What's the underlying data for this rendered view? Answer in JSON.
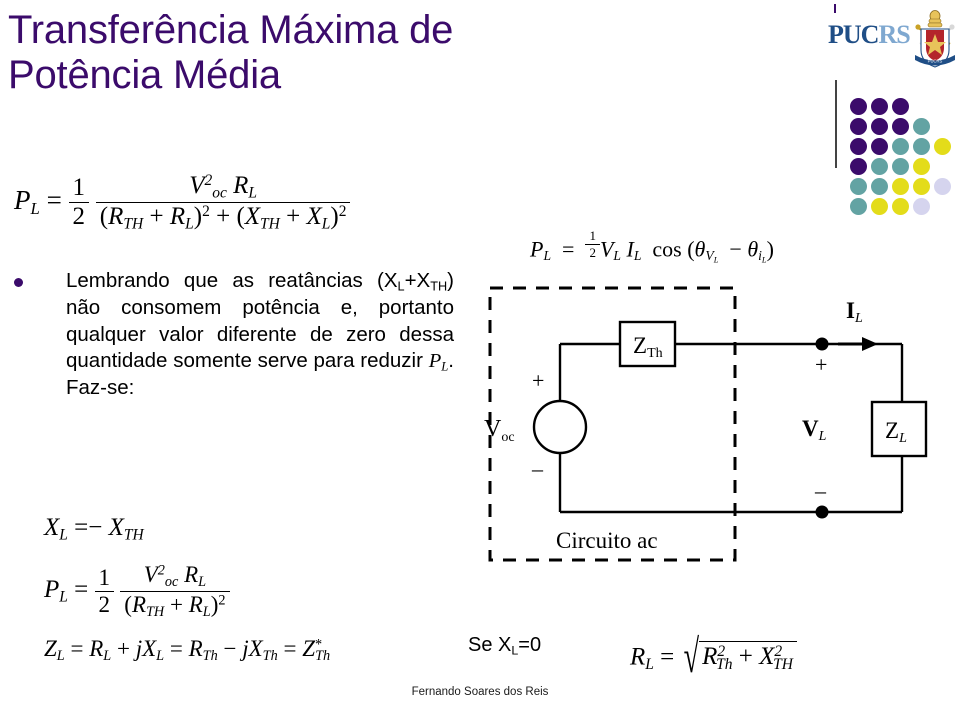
{
  "slide": {
    "title_line1": "Transferência Máxima de",
    "title_line2": "Potência Média",
    "title_color": "#3B0B6B",
    "footer": "Fernando Soares dos Reis",
    "background": "#ffffff"
  },
  "main_formula": {
    "lhs": "P",
    "lhs_sub": "L",
    "equals": "=",
    "half_num": "1",
    "half_den": "2",
    "numerator_v": "V",
    "numerator_v_sup": "2",
    "numerator_v_sub": "oc",
    "numerator_r": "R",
    "numerator_r_sub": "L",
    "den_open1": "(",
    "den_r1": "R",
    "den_r1_sub": "TH",
    "den_plus1": "+",
    "den_r2": "R",
    "den_r2_sub": "L",
    "den_close1": ")",
    "den_sup1": "2",
    "den_plus_mid": "+",
    "den_open2": "(",
    "den_x1": "X",
    "den_x1_sub": "TH",
    "den_plus2": "+",
    "den_x2": "X",
    "den_x2_sub": "L",
    "den_close2": ")",
    "den_sup2": "2"
  },
  "bullet": {
    "marker_color": "#3B0B6B",
    "text_part1": "Lembrando que as reatâncias (X",
    "sub1": "L",
    "text_part2": "+X",
    "sub2": "TH",
    "text_part3": ") não consomem potência e, portanto qualquer valor diferente de zero dessa quantidade somente serve para reduzir ",
    "var_p": "P",
    "var_p_sub": "L",
    "text_part4": ". Faz-se:"
  },
  "formula_xl": {
    "lhs": "X",
    "lhs_sub": "L",
    "equals": "=",
    "minus": "−",
    "rhs": "X",
    "rhs_sub": "TH"
  },
  "formula_pl2": {
    "lhs": "P",
    "lhs_sub": "L",
    "equals": "=",
    "half_num": "1",
    "half_den": "2",
    "numerator_v": "V",
    "numerator_v_sup": "2",
    "numerator_v_sub": "oc",
    "numerator_r": "R",
    "numerator_r_sub": "L",
    "den_open": "(",
    "den_r1": "R",
    "den_r1_sub": "TH",
    "den_plus": "+",
    "den_r2": "R",
    "den_r2_sub": "L",
    "den_close": ")",
    "den_sup": "2"
  },
  "formula_zl": {
    "lhs": "Z",
    "lhs_sub": "L",
    "eq1": "=",
    "r": "R",
    "r_sub": "L",
    "plus": "+",
    "j1": "j",
    "x1": "X",
    "x1_sub": "L",
    "eq2": "=",
    "r2": "R",
    "r2_sub": "Th",
    "minus": "−",
    "j2": "j",
    "x2": "X",
    "x2_sub": "Th",
    "eq3": "=",
    "z2": "Z",
    "z2_star": "*",
    "z2_sub": "Th"
  },
  "pl_definition": {
    "lhs": "P",
    "lhs_sub": "L",
    "equals": "=",
    "half_num": "1",
    "half_den": "2",
    "v": "V",
    "v_sub": "L",
    "i": "I",
    "i_sub": "L",
    "cos": "cos",
    "open": "(",
    "theta1": "θ",
    "theta1_sub": "V",
    "theta1_subsub": "L",
    "minus": "−",
    "theta2": "θ",
    "theta2_sub": "i",
    "theta2_subsub": "L",
    "close": ")"
  },
  "circuit": {
    "caption": "Circuito ac",
    "source_label": "V",
    "source_sub": "oc",
    "source_plus": "+",
    "source_minus": "−",
    "zth_label": "Z",
    "zth_sub": "Th",
    "zl_label": "Z",
    "zl_sub": "L",
    "vl_label": "V",
    "vl_sub": "L",
    "il_label": "I",
    "il_sub": "L",
    "node_plus": "+",
    "node_minus": "−",
    "line_color": "#000000",
    "dashed_color": "#000000"
  },
  "se_condition": {
    "prefix": "Se X",
    "sub": "L",
    "suffix": "=0"
  },
  "formula_rl": {
    "lhs": "R",
    "lhs_sub": "L",
    "equals": "=",
    "r": "R",
    "r_sub": "Th",
    "r_sup": "2",
    "plus": "+",
    "x": "X",
    "x_sub": "TH",
    "x_sup": "2"
  },
  "logo": {
    "wordmark_puc": "PUC",
    "wordmark_rs": "RS",
    "wordmark_color": "#1F4E86",
    "wordmark_color_light": "#7FA8D0"
  },
  "dot_grid": {
    "colors": {
      "purple": "#3B0B6B",
      "teal": "#63A3A3",
      "yellow": "#E3DC1A",
      "lavender": "#D5D4EE"
    },
    "rows": [
      [
        "purple",
        "purple",
        "purple",
        null,
        null
      ],
      [
        "purple",
        "purple",
        "purple",
        "teal",
        null
      ],
      [
        "purple",
        "purple",
        "teal",
        "teal",
        "yellow"
      ],
      [
        "purple",
        "teal",
        "teal",
        "yellow",
        null
      ],
      [
        "teal",
        "teal",
        "yellow",
        "yellow",
        "lavender"
      ],
      [
        "teal",
        "yellow",
        "yellow",
        "lavender",
        null
      ]
    ]
  }
}
